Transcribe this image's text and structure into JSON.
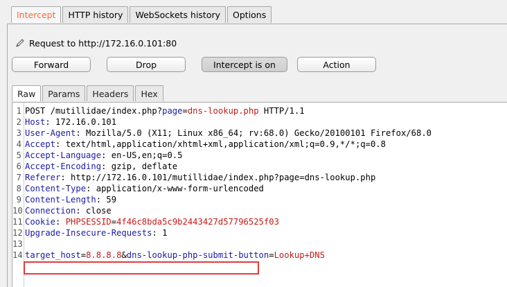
{
  "top_tabs": [
    "Intercept",
    "HTTP history",
    "WebSockets history",
    "Options"
  ],
  "request_label": "Request to http://172.16.0.101:80",
  "buttons": {
    "forward": "Forward",
    "drop": "Drop",
    "intercept": "Intercept is on",
    "action": "Action"
  },
  "sub_tabs": [
    "Raw",
    "Params",
    "Headers",
    "Hex"
  ],
  "colors": {
    "active_tab": "#ff6633",
    "header_name": "#1a1aa6",
    "param_value": "#c41a16",
    "highlight_border": "#e33b3b"
  },
  "request_lines": [
    {
      "n": "1",
      "parts": [
        [
          "p",
          "POST /mutillidae/index.php?"
        ],
        [
          "k",
          "page"
        ],
        [
          "p",
          "="
        ],
        [
          "v",
          "dns-lookup.php"
        ],
        [
          "p",
          " HTTP/1.1"
        ]
      ]
    },
    {
      "n": "2",
      "parts": [
        [
          "k",
          "Host"
        ],
        [
          "p",
          ": 172.16.0.101"
        ]
      ]
    },
    {
      "n": "3",
      "parts": [
        [
          "k",
          "User-Agent"
        ],
        [
          "p",
          ": Mozilla/5.0 (X11; Linux x86_64; rv:68.0) Gecko/20100101 Firefox/68.0"
        ]
      ]
    },
    {
      "n": "4",
      "parts": [
        [
          "k",
          "Accept"
        ],
        [
          "p",
          ": text/html,application/xhtml+xml,application/xml;q=0.9,*/*;q=0.8"
        ]
      ]
    },
    {
      "n": "5",
      "parts": [
        [
          "k",
          "Accept-Language"
        ],
        [
          "p",
          ": en-US,en;q=0.5"
        ]
      ]
    },
    {
      "n": "6",
      "parts": [
        [
          "k",
          "Accept-Encoding"
        ],
        [
          "p",
          ": gzip, deflate"
        ]
      ]
    },
    {
      "n": "7",
      "parts": [
        [
          "k",
          "Referer"
        ],
        [
          "p",
          ": http://172.16.0.101/mutillidae/index.php?page=dns-lookup.php"
        ]
      ]
    },
    {
      "n": "8",
      "parts": [
        [
          "k",
          "Content-Type"
        ],
        [
          "p",
          ": application/x-www-form-urlencoded"
        ]
      ]
    },
    {
      "n": "9",
      "parts": [
        [
          "k",
          "Content-Length"
        ],
        [
          "p",
          ": 59"
        ]
      ]
    },
    {
      "n": "10",
      "parts": [
        [
          "k",
          "Connection"
        ],
        [
          "p",
          ": close"
        ]
      ]
    },
    {
      "n": "11",
      "parts": [
        [
          "k",
          "Cookie"
        ],
        [
          "p",
          ": "
        ],
        [
          "v",
          "PHPSESSID"
        ],
        [
          "p",
          "="
        ],
        [
          "v",
          "4f46c8bda5c9b2443427d57796525f03"
        ]
      ]
    },
    {
      "n": "12",
      "parts": [
        [
          "k",
          "Upgrade-Insecure-Requests"
        ],
        [
          "p",
          ": 1"
        ]
      ]
    },
    {
      "n": "13",
      "parts": []
    },
    {
      "n": "14",
      "parts": [
        [
          "k",
          "target_host"
        ],
        [
          "p",
          "="
        ],
        [
          "v",
          "8.8.8.8"
        ],
        [
          "p",
          "&"
        ],
        [
          "k",
          "dns-lookup-php-submit-button"
        ],
        [
          "p",
          "="
        ],
        [
          "v",
          "Lookup+DNS"
        ]
      ]
    }
  ]
}
